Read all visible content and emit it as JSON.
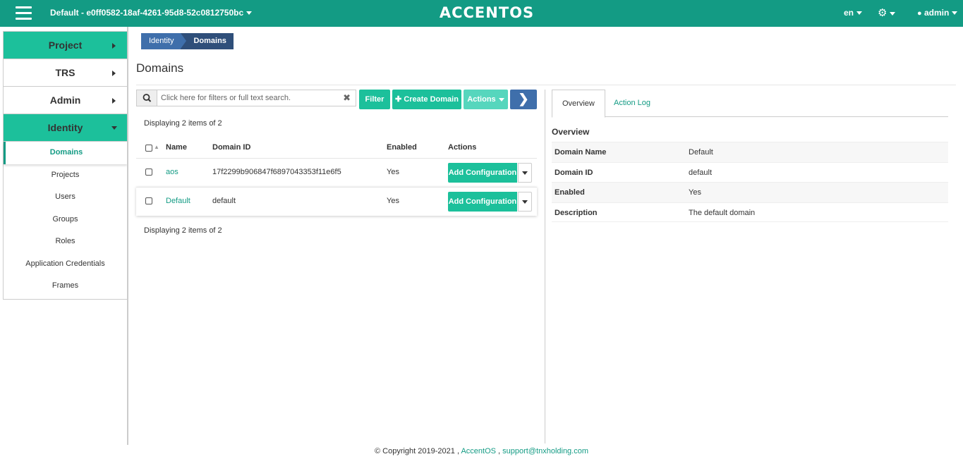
{
  "topbar": {
    "project": "Default - e0ff0582-18af-4261-95d8-52c0812750bc",
    "logo": "ACCENTOS",
    "lang": "en",
    "user": "admin"
  },
  "sidebar": {
    "sections": [
      {
        "label": "Project"
      },
      {
        "label": "TRS"
      },
      {
        "label": "Admin"
      },
      {
        "label": "Identity"
      }
    ],
    "identity_items": [
      {
        "label": "Domains"
      },
      {
        "label": "Projects"
      },
      {
        "label": "Users"
      },
      {
        "label": "Groups"
      },
      {
        "label": "Roles"
      },
      {
        "label": "Application Credentials"
      },
      {
        "label": "Frames"
      }
    ]
  },
  "breadcrumb": [
    "Identity",
    "Domains"
  ],
  "page_title": "Domains",
  "toolbar": {
    "search_placeholder": "Click here for filters or full text search.",
    "filter_label": "Filter",
    "create_label": "Create Domain",
    "actions_label": "Actions"
  },
  "table": {
    "displaying": "Displaying 2 items of 2",
    "columns": {
      "name": "Name",
      "domain_id": "Domain ID",
      "enabled": "Enabled",
      "actions": "Actions"
    },
    "rows": [
      {
        "name": "aos",
        "domain_id": "17f2299b906847f6897043353f11e6f5",
        "enabled": "Yes",
        "action": "Add Configuration"
      },
      {
        "name": "Default",
        "domain_id": "default",
        "enabled": "Yes",
        "action": "Add Configuration"
      }
    ]
  },
  "detail": {
    "tabs": [
      "Overview",
      "Action Log"
    ],
    "title": "Overview",
    "rows": [
      {
        "key": "Domain Name",
        "value": "Default"
      },
      {
        "key": "Domain ID",
        "value": "default"
      },
      {
        "key": "Enabled",
        "value": "Yes"
      },
      {
        "key": "Description",
        "value": "The default domain"
      }
    ]
  },
  "footer": {
    "copyright": "© Copyright 2019-2021 ,",
    "brand": "AccentOS",
    "sep": ",",
    "email": "support@tnxholding.com"
  },
  "colors": {
    "brand": "#139b84",
    "accent": "#1cc09b",
    "nav_blue": "#3f6fab"
  }
}
